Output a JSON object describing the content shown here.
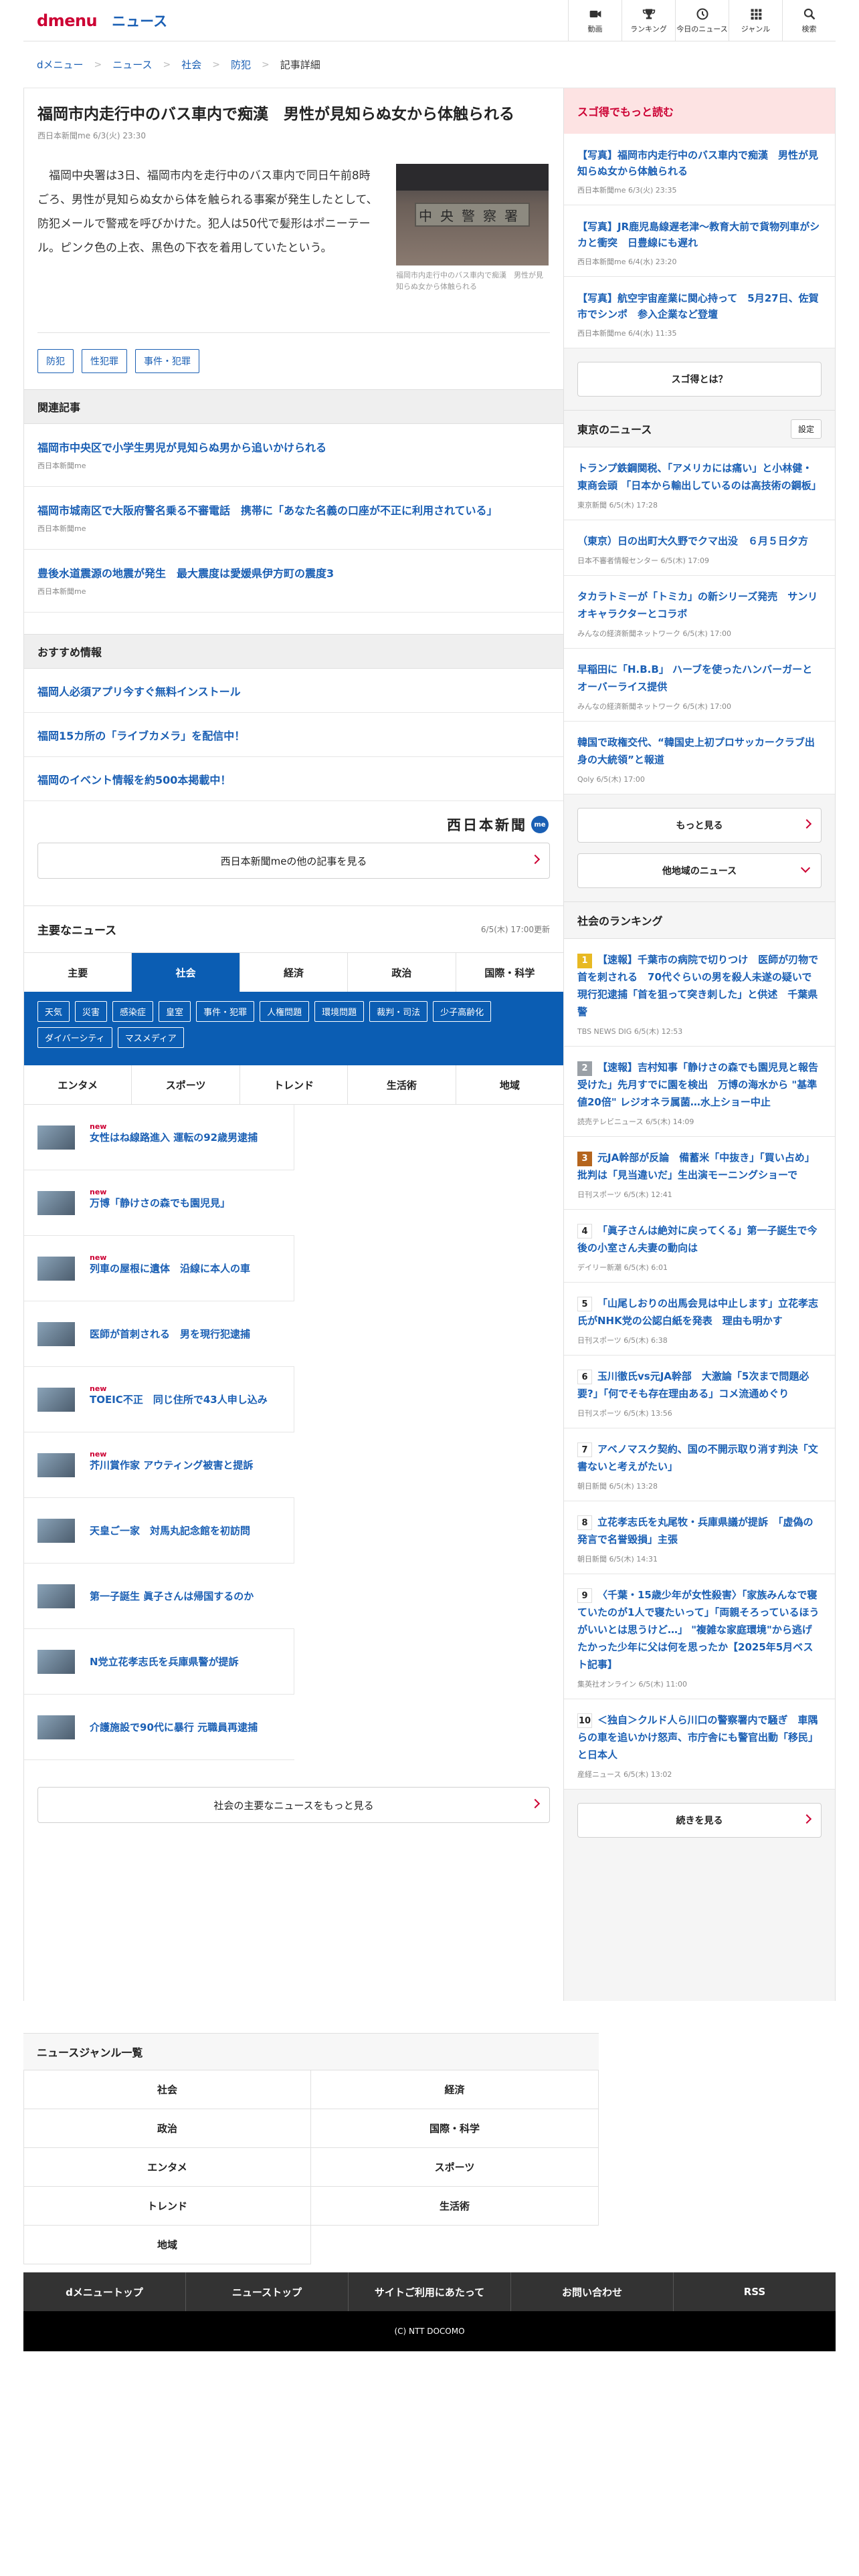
{
  "header": {
    "logo_d": "dmenu",
    "logo_news": "ニュース",
    "nav": [
      {
        "label": "動画",
        "icon": "video-icon"
      },
      {
        "label": "ランキング",
        "icon": "trophy-icon"
      },
      {
        "label": "今日のニュース",
        "icon": "clock-icon"
      },
      {
        "label": "ジャンル",
        "icon": "grid-icon"
      },
      {
        "label": "検索",
        "icon": "search-icon"
      }
    ]
  },
  "breadcrumb": [
    "dメニュー",
    "ニュース",
    "社会",
    "防犯",
    "記事詳細"
  ],
  "article": {
    "title": "福岡市内走行中のバス車内で痴漢　男性が見知らぬ女から体触られる",
    "meta": "西日本新聞me 6/3(火) 23:30",
    "body": "福岡中央署は3日、福岡市内を走行中のバス車内で同日午前8時ごろ、男性が見知らぬ女から体を触られる事案が発生したとして、防犯メールで警戒を呼びかけた。犯人は50代で髪形はポニーテール。ピンク色の上衣、黒色の下衣を着用していたという。",
    "photo_sign": "中央警察署",
    "photo_caption": "福岡市内走行中のバス車内で痴漢　男性が見知らぬ女から体触られる",
    "tags": [
      "防犯",
      "性犯罪",
      "事件・犯罪"
    ]
  },
  "related": {
    "heading": "関連記事",
    "items": [
      {
        "title": "福岡市中央区で小学生男児が見知らぬ男から追いかけられる",
        "source": "西日本新聞me"
      },
      {
        "title": "福岡市城南区で大阪府警名乗る不審電話　携帯に「あなた名義の口座が不正に利用されている」",
        "source": "西日本新聞me"
      },
      {
        "title": "豊後水道震源の地震が発生　最大震度は愛媛県伊方町の震度3",
        "source": "西日本新聞me"
      }
    ]
  },
  "recommend": {
    "heading": "おすすめ情報",
    "items": [
      "福岡人必須アプリ今すぐ無料インストール",
      "福岡15カ所の「ライブカメラ」を配信中！",
      "福岡のイベント情報を約500本掲載中！"
    ]
  },
  "publisher": {
    "logo": "西日本新聞",
    "badge": "me",
    "more_label": "西日本新聞meの他の記事を見る"
  },
  "main_news": {
    "heading": "主要なニュース",
    "updated": "6/5(木) 17:00更新",
    "tabs": [
      "主要",
      "社会",
      "経済",
      "政治",
      "国際・科学"
    ],
    "active_tab": "社会",
    "subtags": [
      "天気",
      "災害",
      "感染症",
      "皇室",
      "事件・犯罪",
      "人権問題",
      "環境問題",
      "裁判・司法",
      "少子高齢化",
      "ダイバーシティ",
      "マスメディア"
    ],
    "tabs2": [
      "エンタメ",
      "スポーツ",
      "トレンド",
      "生活術",
      "地域"
    ],
    "new_label": "new",
    "items": [
      {
        "title": "女性はね線路進入 運転の92歳男逮捕",
        "new": true
      },
      {
        "title": "万博「静けさの森でも園児見」",
        "new": true
      },
      {
        "title": "列車の屋根に遺体　沿線に本人の車",
        "new": true
      },
      {
        "title": "医師が首刺される　男を現行犯逮捕",
        "new": false
      },
      {
        "title": "TOEIC不正　同じ住所で43人申し込み",
        "new": true
      },
      {
        "title": "芥川賞作家 アウティング被害と提訴",
        "new": true
      },
      {
        "title": "天皇ご一家　対馬丸記念館を初訪問",
        "new": false
      },
      {
        "title": "第一子誕生 眞子さんは帰国するのか",
        "new": false
      },
      {
        "title": "N党立花孝志氏を兵庫県警が提訴",
        "new": false
      },
      {
        "title": "介護施設で90代に暴行 元職員再逮捕",
        "new": false
      }
    ],
    "more_label": "社会の主要なニュースをもっと見る"
  },
  "sugo": {
    "heading": "スゴ得でもっと読む",
    "items": [
      {
        "title": "【写真】福岡市内走行中のバス車内で痴漢　男性が見知らぬ女から体触られる",
        "source": "西日本新聞me 6/3(火) 23:35"
      },
      {
        "title": "【写真】JR鹿児島線遅老津〜教育大前で貨物列車がシカと衝突　日豊線にも遅れ",
        "source": "西日本新聞me 6/4(水) 23:20"
      },
      {
        "title": "【写真】航空宇宙産業に関心持って　5月27日、佐賀市でシンポ　参入企業など登壇",
        "source": "西日本新聞me 6/4(水) 11:35"
      }
    ],
    "button": "スゴ得とは？"
  },
  "tokyo": {
    "heading": "東京のニュース",
    "setting": "設定",
    "items": [
      {
        "title": "トランプ鉄鋼関税、「アメリカには痛い」と小林健・東商会頭 「日本から輸出しているのは高技術の鋼板」",
        "source": "東京新聞 6/5(木) 17:28"
      },
      {
        "title": "（東京）日の出町大久野でクマ出没　６月５日夕方",
        "source": "日本不審者情報センター 6/5(木) 17:09"
      },
      {
        "title": "タカラトミーが「トミカ」の新シリーズ発売　サンリオキャラクターとコラボ",
        "source": "みんなの経済新聞ネットワーク 6/5(木) 17:00"
      },
      {
        "title": "早稲田に「H.B.B」 ハーブを使ったハンバーガーとオーバーライス提供",
        "source": "みんなの経済新聞ネットワーク 6/5(木) 17:00"
      },
      {
        "title": "韓国で政権交代、“韓国史上初プロサッカークラブ出身の大統領”と報道",
        "source": "Qoly 6/5(木) 17:00"
      }
    ],
    "more": "もっと見る",
    "other": "他地域のニュース"
  },
  "ranking": {
    "heading": "社会のランキング",
    "items": [
      {
        "n": "1",
        "title": "【速報】千葉市の病院で切りつけ　医師が刃物で首を刺される　70代ぐらいの男を殺人未遂の疑いで現行犯逮捕「首を狙って突き刺した」と供述　千葉県警",
        "source": "TBS NEWS DIG 6/5(木) 12:53"
      },
      {
        "n": "2",
        "title": "【速報】吉村知事「静けさの森でも園児見と報告受けた」先月すでに園を検出　万博の海水から \"基準値20倍\" レジオネラ属菌…水上ショー中止",
        "source": "読売テレビニュース 6/5(木) 14:09"
      },
      {
        "n": "3",
        "title": "元JA幹部が反論　備蓄米「中抜き」「買い占め」批判は「見当違いだ」生出演モーニングショーで",
        "source": "日刊スポーツ 6/5(木) 12:41"
      },
      {
        "n": "4",
        "title": "「眞子さんは絶対に戻ってくる」第一子誕生で今後の小室さん夫妻の動向は",
        "source": "デイリー新潮 6/5(木) 6:01"
      },
      {
        "n": "5",
        "title": "「山尾しおりの出馬会見は中止します」立花孝志氏がNHK党の公認白紙を発表　理由も明かす",
        "source": "日刊スポーツ 6/5(木) 6:38"
      },
      {
        "n": "6",
        "title": "玉川徹氏vs元JA幹部　大激論「5次まで問題必要?」「何でそも存在理由ある」コメ流通めぐり",
        "source": "日刊スポーツ 6/5(木) 13:56"
      },
      {
        "n": "7",
        "title": "アベノマスク契約、国の不開示取り消す判決「文書ないと考えがたい」",
        "source": "朝日新聞 6/5(木) 13:28"
      },
      {
        "n": "8",
        "title": "立花孝志氏を丸尾牧・兵庫県議が提訴　「虚偽の発言で名誉毀損」主張",
        "source": "朝日新聞 6/5(木) 14:31"
      },
      {
        "n": "9",
        "title": "〈千葉・15歳少年が女性殺害〉「家族みんなで寝ていたのが1人で寝たいって」「両親そろっているほうがいいとは思うけど…」 \"複雑な家庭環境\"から逃げたかった少年に父は何を思ったか【2025年5月ベスト記事】",
        "source": "集英社オンライン 6/5(木) 11:00"
      },
      {
        "n": "10",
        "title": "＜独自＞クルド人ら川口の警察署内で騒ぎ　車隅らの車を追いかけ怒声、市庁舎にも警官出動「移民」と日本人",
        "source": "産経ニュース 6/5(木) 13:02"
      }
    ],
    "more": "続きを見る"
  },
  "genre": {
    "heading": "ニュースジャンル一覧",
    "items": [
      "社会",
      "経済",
      "政治",
      "国際・科学",
      "エンタメ",
      "スポーツ",
      "トレンド",
      "生活術",
      "地域"
    ]
  },
  "footer": {
    "links": [
      "dメニュートップ",
      "ニューストップ",
      "サイトご利用にあたって",
      "お問い合わせ",
      "RSS"
    ],
    "copyright": "(C) NTT DOCOMO"
  }
}
